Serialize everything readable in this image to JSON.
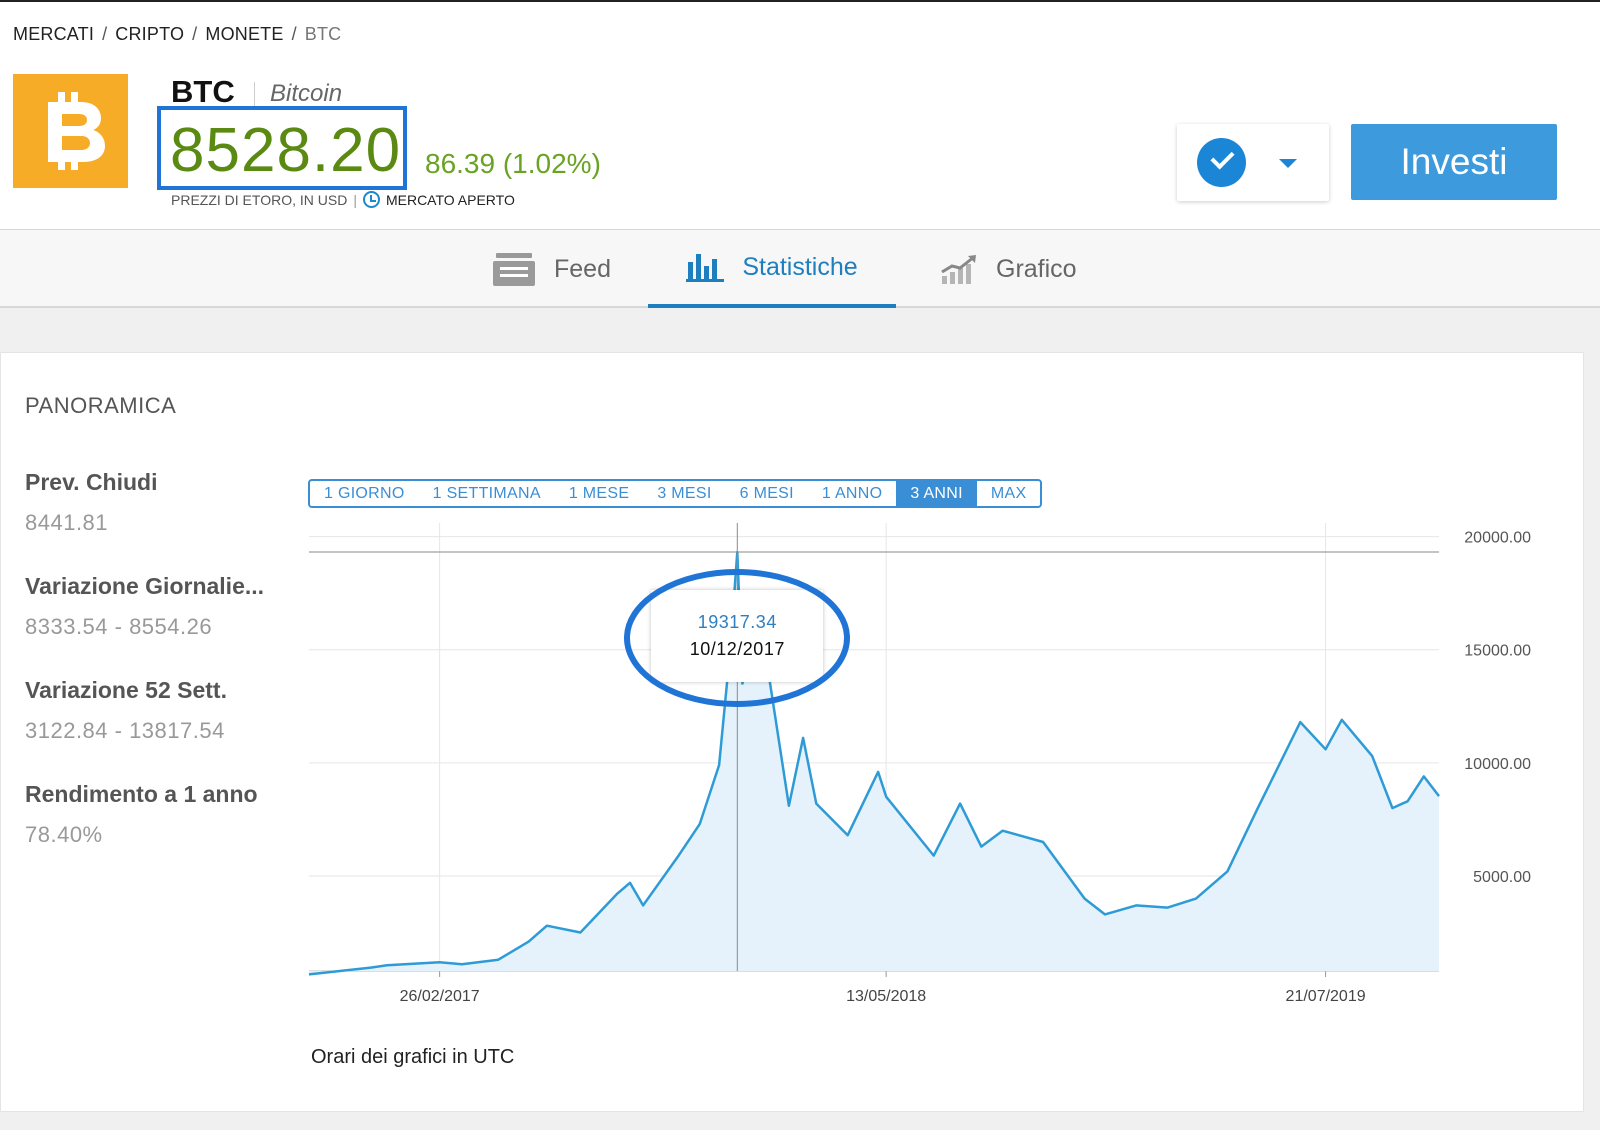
{
  "breadcrumb": {
    "items": [
      "MERCATI",
      "CRIPTO",
      "MONETE"
    ],
    "current": "BTC"
  },
  "asset": {
    "symbol": "BTC",
    "name": "Bitcoin",
    "price": "8528.20",
    "change": "86.39 (1.02%)",
    "source": "PREZZI DI ETORO, IN USD",
    "market_status": "MERCATO APERTO",
    "logo_icon": "bitcoin-icon",
    "logo_color": "#f7ac28"
  },
  "actions": {
    "invest_label": "Investi",
    "watch_icon": "check-icon",
    "menu_icon": "chevron-down-icon"
  },
  "tabs": [
    {
      "label": "Feed",
      "icon": "feed-icon",
      "active": false
    },
    {
      "label": "Statistiche",
      "icon": "bar-chart-icon",
      "active": true
    },
    {
      "label": "Grafico",
      "icon": "line-chart-icon",
      "active": false
    }
  ],
  "overview": {
    "title": "PANORAMICA",
    "stats": [
      {
        "label": "Prev. Chiudi",
        "value": "8441.81"
      },
      {
        "label": "Variazione Giornalie...",
        "value": "8333.54 - 8554.26"
      },
      {
        "label": "Variazione 52 Sett.",
        "value": "3122.84 - 13817.54"
      },
      {
        "label": "Rendimento a 1 anno",
        "value": "78.40%"
      }
    ],
    "ranges": [
      "1 GIORNO",
      "1 SETTIMANA",
      "1 MESE",
      "3 MESI",
      "6 MESI",
      "1 ANNO",
      "3 ANNI",
      "MAX"
    ],
    "selected_range": "3 ANNI",
    "footnote": "Orari dei grafici in UTC"
  },
  "chart_data": {
    "type": "area",
    "y_ticks": [
      "20000.00",
      "15000.00",
      "10000.00",
      "5000.00"
    ],
    "x_ticks": [
      "26/02/2017",
      "13/05/2018",
      "21/07/2019"
    ],
    "ylim": [
      800,
      20600
    ],
    "x": [
      "2016-10-20",
      "2016-11-15",
      "2016-12-20",
      "2017-01-05",
      "2017-02-26",
      "2017-03-20",
      "2017-04-25",
      "2017-05-25",
      "2017-06-12",
      "2017-07-15",
      "2017-08-20",
      "2017-09-02",
      "2017-09-15",
      "2017-10-20",
      "2017-11-10",
      "2017-11-29",
      "2017-12-10",
      "2017-12-17",
      "2017-12-22",
      "2018-01-06",
      "2018-02-06",
      "2018-02-20",
      "2018-03-05",
      "2018-04-05",
      "2018-05-05",
      "2018-05-13",
      "2018-06-29",
      "2018-07-25",
      "2018-08-15",
      "2018-09-05",
      "2018-10-15",
      "2018-11-25",
      "2018-12-15",
      "2019-01-15",
      "2019-02-15",
      "2019-03-15",
      "2019-04-15",
      "2019-05-15",
      "2019-06-26",
      "2019-07-21",
      "2019-08-06",
      "2019-09-05",
      "2019-09-25",
      "2019-10-10",
      "2019-10-26",
      "2019-11-10"
    ],
    "y": [
      650,
      780,
      950,
      1050,
      1190,
      1100,
      1300,
      2100,
      2800,
      2500,
      4200,
      4700,
      3700,
      5900,
      7300,
      9900,
      15000,
      19317.34,
      13500,
      17100,
      8100,
      11100,
      8200,
      6800,
      9600,
      8500,
      5900,
      8200,
      6300,
      7000,
      6500,
      4000,
      3300,
      3700,
      3600,
      4000,
      5200,
      8000,
      11800,
      10600,
      11900,
      10300,
      8000,
      8300,
      9400,
      8528.2
    ],
    "tooltip": {
      "value": "19317.34",
      "date": "10/12/2017"
    },
    "line_color": "#2e9bd6",
    "fill_color": "#e5f2fb"
  },
  "annotations": {
    "highlight_color": "#1f74d6"
  }
}
